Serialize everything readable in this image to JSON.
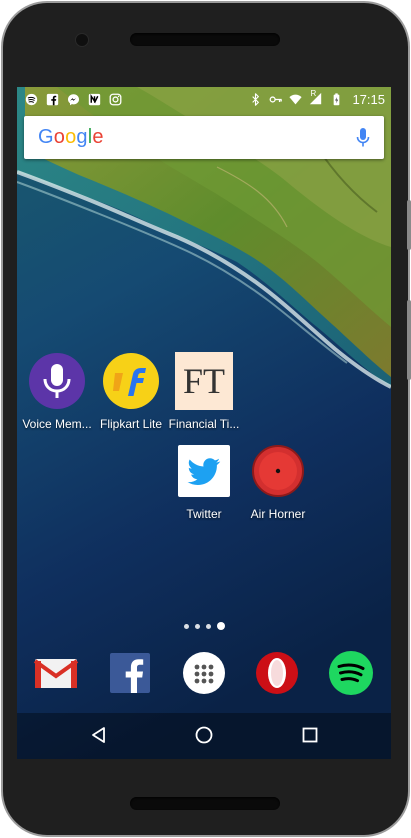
{
  "status_bar": {
    "time": "17:15",
    "left_icons": [
      "spotify-notification-icon",
      "facebook-notification-icon",
      "messenger-notification-icon",
      "nova-notification-icon",
      "instagram-notification-icon"
    ],
    "right_icons": [
      "bluetooth-icon",
      "vpn-key-icon",
      "wifi-icon",
      "signal-icon",
      "battery-icon"
    ],
    "signal_marker": "R"
  },
  "search": {
    "brand": "Google",
    "brand_colors": [
      "#4285F4",
      "#EA4335",
      "#FBBC05",
      "#4285F4",
      "#34A853",
      "#EA4335"
    ],
    "mic_color": "#4285F4"
  },
  "apps": [
    {
      "label": "Voice Mem...",
      "icon": "voice-memos-icon",
      "color": "#5c35a8"
    },
    {
      "label": "Flipkart Lite",
      "icon": "flipkart-icon",
      "color": "#f7d117"
    },
    {
      "label": "Financial Ti...",
      "icon": "financial-times-icon",
      "color": "#fde8d4",
      "glyph": "FT"
    },
    {
      "label": "Twitter",
      "icon": "twitter-icon",
      "color": "#1da1f2"
    },
    {
      "label": "Air Horner",
      "icon": "air-horner-icon",
      "color": "#d32f2f"
    }
  ],
  "page_indicator": {
    "pages": 4,
    "active": 4
  },
  "dock": [
    {
      "name": "gmail",
      "icon": "gmail-icon"
    },
    {
      "name": "facebook",
      "icon": "facebook-icon"
    },
    {
      "name": "app-drawer",
      "icon": "app-drawer-icon"
    },
    {
      "name": "opera",
      "icon": "opera-icon"
    },
    {
      "name": "spotify",
      "icon": "spotify-icon"
    }
  ],
  "navigation": [
    "back-icon",
    "home-icon",
    "recents-icon"
  ]
}
